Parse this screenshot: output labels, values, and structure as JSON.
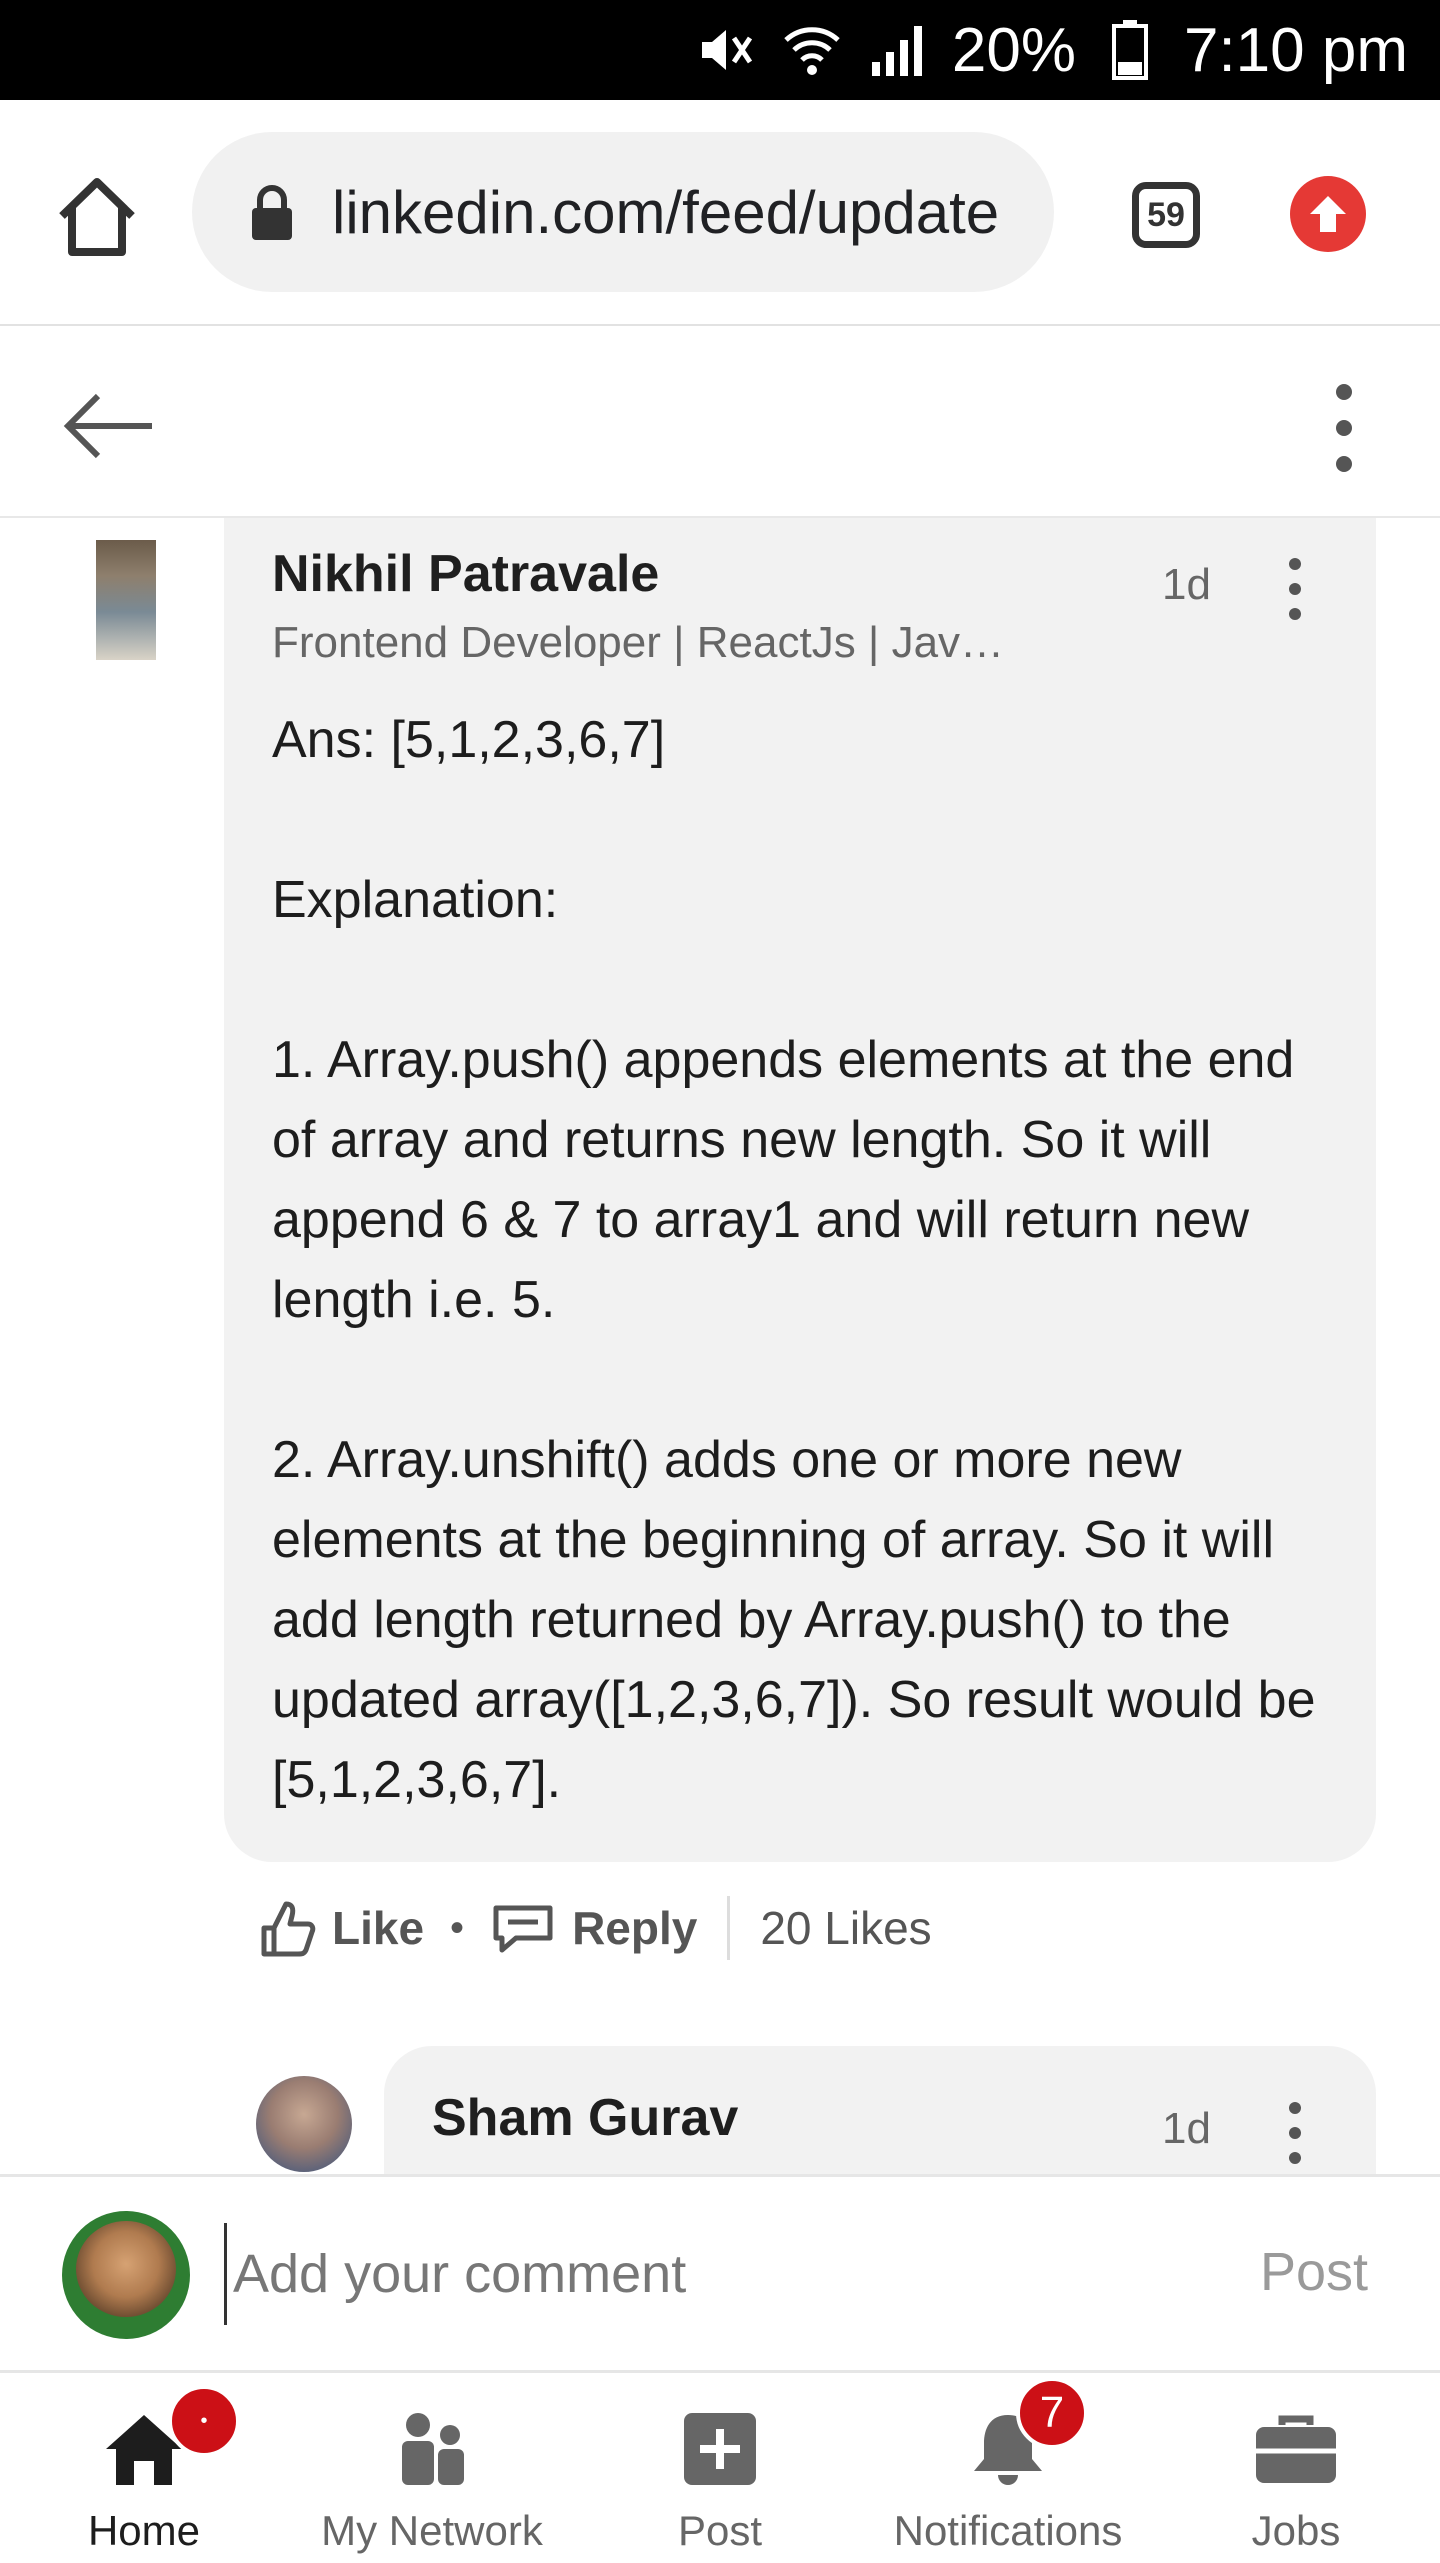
{
  "status_bar": {
    "battery": "20%",
    "time": "7:10 pm"
  },
  "browser": {
    "url": "linkedin.com/feed/update",
    "tab_count": "59"
  },
  "comment1": {
    "author": "Nikhil Patravale",
    "headline": "Frontend Developer | ReactJs | Jav…",
    "time": "1d",
    "body": [
      "Ans: [5,1,2,3,6,7]",
      "",
      "Explanation:",
      "",
      "1. Array.push() appends elements at the end of array and returns new length. So it will append 6 & 7 to array1 and will return new length i.e. 5.",
      "",
      "2. Array.unshift() adds one or more new elements at the beginning of array. So it will add length returned by Array.push() to the updated array([1,2,3,6,7]). So result would be [5,1,2,3,6,7]."
    ],
    "like_label": "Like",
    "reply_label": "Reply",
    "likes_count": "20 Likes"
  },
  "comment2": {
    "author": "Sham Gurav",
    "time": "1d"
  },
  "composer": {
    "placeholder": "Add your comment",
    "post_label": "Post"
  },
  "bottom_nav": {
    "items": [
      {
        "label": "Home",
        "icon": "home-icon"
      },
      {
        "label": "My Network",
        "icon": "network-icon"
      },
      {
        "label": "Post",
        "icon": "post-icon"
      },
      {
        "label": "Notifications",
        "icon": "bell-icon",
        "badge": "7"
      },
      {
        "label": "Jobs",
        "icon": "briefcase-icon"
      }
    ]
  },
  "colors": {
    "accent_red": "#cc1016",
    "bubble_bg": "#f2f2f2",
    "browser_update": "#e53935"
  }
}
